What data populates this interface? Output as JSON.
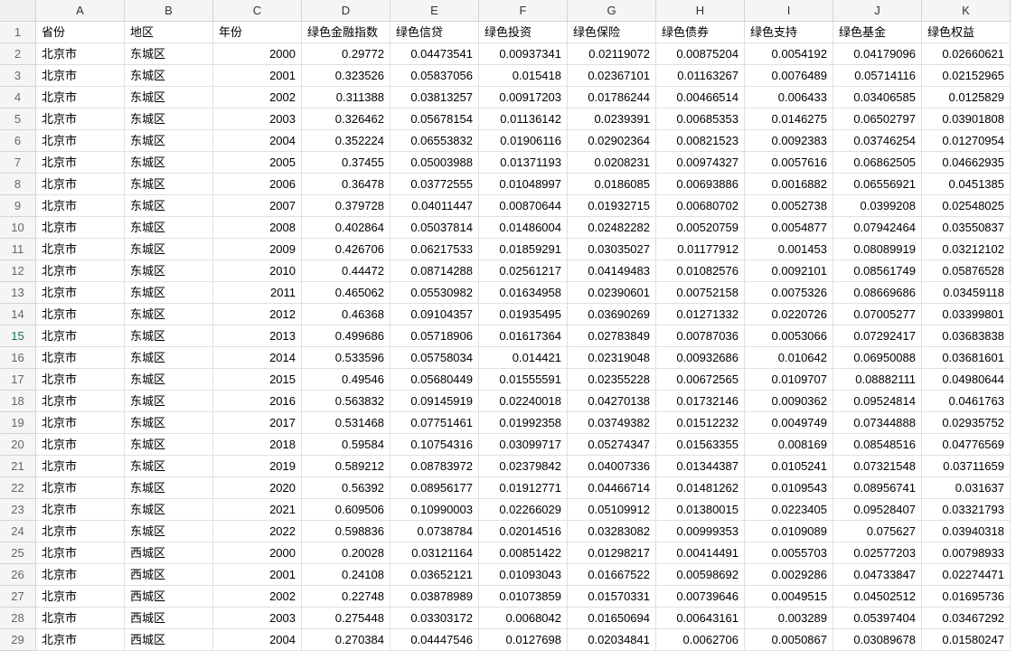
{
  "columns": [
    "A",
    "B",
    "C",
    "D",
    "E",
    "F",
    "G",
    "H",
    "I",
    "J",
    "K"
  ],
  "headers": [
    "省份",
    "地区",
    "年份",
    "绿色金融指数",
    "绿色信贷",
    "绿色投资",
    "绿色保险",
    "绿色债券",
    "绿色支持",
    "绿色基金",
    "绿色权益"
  ],
  "selectedRow": 15,
  "rows": [
    {
      "n": 2,
      "p": "北京市",
      "d": "东城区",
      "y": "2000",
      "v": [
        "0.29772",
        "0.04473541",
        "0.00937341",
        "0.02119072",
        "0.00875204",
        "0.0054192",
        "0.04179096",
        "0.02660621"
      ]
    },
    {
      "n": 3,
      "p": "北京市",
      "d": "东城区",
      "y": "2001",
      "v": [
        "0.323526",
        "0.05837056",
        "0.015418",
        "0.02367101",
        "0.01163267",
        "0.0076489",
        "0.05714116",
        "0.02152965"
      ]
    },
    {
      "n": 4,
      "p": "北京市",
      "d": "东城区",
      "y": "2002",
      "v": [
        "0.311388",
        "0.03813257",
        "0.00917203",
        "0.01786244",
        "0.00466514",
        "0.006433",
        "0.03406585",
        "0.0125829"
      ]
    },
    {
      "n": 5,
      "p": "北京市",
      "d": "东城区",
      "y": "2003",
      "v": [
        "0.326462",
        "0.05678154",
        "0.01136142",
        "0.0239391",
        "0.00685353",
        "0.0146275",
        "0.06502797",
        "0.03901808"
      ]
    },
    {
      "n": 6,
      "p": "北京市",
      "d": "东城区",
      "y": "2004",
      "v": [
        "0.352224",
        "0.06553832",
        "0.01906116",
        "0.02902364",
        "0.00821523",
        "0.0092383",
        "0.03746254",
        "0.01270954"
      ]
    },
    {
      "n": 7,
      "p": "北京市",
      "d": "东城区",
      "y": "2005",
      "v": [
        "0.37455",
        "0.05003988",
        "0.01371193",
        "0.0208231",
        "0.00974327",
        "0.0057616",
        "0.06862505",
        "0.04662935"
      ]
    },
    {
      "n": 8,
      "p": "北京市",
      "d": "东城区",
      "y": "2006",
      "v": [
        "0.36478",
        "0.03772555",
        "0.01048997",
        "0.0186085",
        "0.00693886",
        "0.0016882",
        "0.06556921",
        "0.0451385"
      ]
    },
    {
      "n": 9,
      "p": "北京市",
      "d": "东城区",
      "y": "2007",
      "v": [
        "0.379728",
        "0.04011447",
        "0.00870644",
        "0.01932715",
        "0.00680702",
        "0.0052738",
        "0.0399208",
        "0.02548025"
      ]
    },
    {
      "n": 10,
      "p": "北京市",
      "d": "东城区",
      "y": "2008",
      "v": [
        "0.402864",
        "0.05037814",
        "0.01486004",
        "0.02482282",
        "0.00520759",
        "0.0054877",
        "0.07942464",
        "0.03550837"
      ]
    },
    {
      "n": 11,
      "p": "北京市",
      "d": "东城区",
      "y": "2009",
      "v": [
        "0.426706",
        "0.06217533",
        "0.01859291",
        "0.03035027",
        "0.01177912",
        "0.001453",
        "0.08089919",
        "0.03212102"
      ]
    },
    {
      "n": 12,
      "p": "北京市",
      "d": "东城区",
      "y": "2010",
      "v": [
        "0.44472",
        "0.08714288",
        "0.02561217",
        "0.04149483",
        "0.01082576",
        "0.0092101",
        "0.08561749",
        "0.05876528"
      ]
    },
    {
      "n": 13,
      "p": "北京市",
      "d": "东城区",
      "y": "2011",
      "v": [
        "0.465062",
        "0.05530982",
        "0.01634958",
        "0.02390601",
        "0.00752158",
        "0.0075326",
        "0.08669686",
        "0.03459118"
      ]
    },
    {
      "n": 14,
      "p": "北京市",
      "d": "东城区",
      "y": "2012",
      "v": [
        "0.46368",
        "0.09104357",
        "0.01935495",
        "0.03690269",
        "0.01271332",
        "0.0220726",
        "0.07005277",
        "0.03399801"
      ]
    },
    {
      "n": 15,
      "p": "北京市",
      "d": "东城区",
      "y": "2013",
      "v": [
        "0.499686",
        "0.05718906",
        "0.01617364",
        "0.02783849",
        "0.00787036",
        "0.0053066",
        "0.07292417",
        "0.03683838"
      ]
    },
    {
      "n": 16,
      "p": "北京市",
      "d": "东城区",
      "y": "2014",
      "v": [
        "0.533596",
        "0.05758034",
        "0.014421",
        "0.02319048",
        "0.00932686",
        "0.010642",
        "0.06950088",
        "0.03681601"
      ]
    },
    {
      "n": 17,
      "p": "北京市",
      "d": "东城区",
      "y": "2015",
      "v": [
        "0.49546",
        "0.05680449",
        "0.01555591",
        "0.02355228",
        "0.00672565",
        "0.0109707",
        "0.08882111",
        "0.04980644"
      ]
    },
    {
      "n": 18,
      "p": "北京市",
      "d": "东城区",
      "y": "2016",
      "v": [
        "0.563832",
        "0.09145919",
        "0.02240018",
        "0.04270138",
        "0.01732146",
        "0.0090362",
        "0.09524814",
        "0.0461763"
      ]
    },
    {
      "n": 19,
      "p": "北京市",
      "d": "东城区",
      "y": "2017",
      "v": [
        "0.531468",
        "0.07751461",
        "0.01992358",
        "0.03749382",
        "0.01512232",
        "0.0049749",
        "0.07344888",
        "0.02935752"
      ]
    },
    {
      "n": 20,
      "p": "北京市",
      "d": "东城区",
      "y": "2018",
      "v": [
        "0.59584",
        "0.10754316",
        "0.03099717",
        "0.05274347",
        "0.01563355",
        "0.008169",
        "0.08548516",
        "0.04776569"
      ]
    },
    {
      "n": 21,
      "p": "北京市",
      "d": "东城区",
      "y": "2019",
      "v": [
        "0.589212",
        "0.08783972",
        "0.02379842",
        "0.04007336",
        "0.01344387",
        "0.0105241",
        "0.07321548",
        "0.03711659"
      ]
    },
    {
      "n": 22,
      "p": "北京市",
      "d": "东城区",
      "y": "2020",
      "v": [
        "0.56392",
        "0.08956177",
        "0.01912771",
        "0.04466714",
        "0.01481262",
        "0.0109543",
        "0.08956741",
        "0.031637"
      ]
    },
    {
      "n": 23,
      "p": "北京市",
      "d": "东城区",
      "y": "2021",
      "v": [
        "0.609506",
        "0.10990003",
        "0.02266029",
        "0.05109912",
        "0.01380015",
        "0.0223405",
        "0.09528407",
        "0.03321793"
      ]
    },
    {
      "n": 24,
      "p": "北京市",
      "d": "东城区",
      "y": "2022",
      "v": [
        "0.598836",
        "0.0738784",
        "0.02014516",
        "0.03283082",
        "0.00999353",
        "0.0109089",
        "0.075627",
        "0.03940318"
      ]
    },
    {
      "n": 25,
      "p": "北京市",
      "d": "西城区",
      "y": "2000",
      "v": [
        "0.20028",
        "0.03121164",
        "0.00851422",
        "0.01298217",
        "0.00414491",
        "0.0055703",
        "0.02577203",
        "0.00798933"
      ]
    },
    {
      "n": 26,
      "p": "北京市",
      "d": "西城区",
      "y": "2001",
      "v": [
        "0.24108",
        "0.03652121",
        "0.01093043",
        "0.01667522",
        "0.00598692",
        "0.0029286",
        "0.04733847",
        "0.02274471"
      ]
    },
    {
      "n": 27,
      "p": "北京市",
      "d": "西城区",
      "y": "2002",
      "v": [
        "0.22748",
        "0.03878989",
        "0.01073859",
        "0.01570331",
        "0.00739646",
        "0.0049515",
        "0.04502512",
        "0.01695736"
      ]
    },
    {
      "n": 28,
      "p": "北京市",
      "d": "西城区",
      "y": "2003",
      "v": [
        "0.275448",
        "0.03303172",
        "0.0068042",
        "0.01650694",
        "0.00643161",
        "0.003289",
        "0.05397404",
        "0.03467292"
      ]
    },
    {
      "n": 29,
      "p": "北京市",
      "d": "西城区",
      "y": "2004",
      "v": [
        "0.270384",
        "0.04447546",
        "0.0127698",
        "0.02034841",
        "0.0062706",
        "0.0050867",
        "0.03089678",
        "0.01580247"
      ]
    }
  ]
}
